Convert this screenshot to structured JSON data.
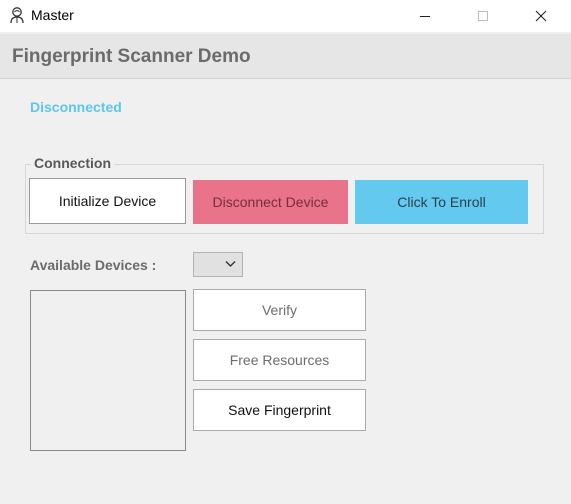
{
  "window": {
    "title": "Master"
  },
  "header": {
    "title": "Fingerprint Scanner Demo"
  },
  "status": {
    "text": "Disconnected",
    "color": "#5bc6ee"
  },
  "connection": {
    "group_label": "Connection",
    "initialize_label": "Initialize Device",
    "disconnect_label": "Disconnect Device",
    "enroll_label": "Click To Enroll",
    "colors": {
      "disconnect": "#e8738a",
      "enroll": "#63c9ef"
    }
  },
  "devices": {
    "label": "Available Devices :",
    "selected": ""
  },
  "actions": {
    "verify_label": "Verify",
    "free_label": "Free Resources",
    "save_label": "Save Fingerprint"
  },
  "icons": {
    "app": "fingerprint-user-icon",
    "minimize": "minimize-icon",
    "maximize": "maximize-icon",
    "close": "close-icon",
    "dropdown": "chevron-down-icon"
  }
}
